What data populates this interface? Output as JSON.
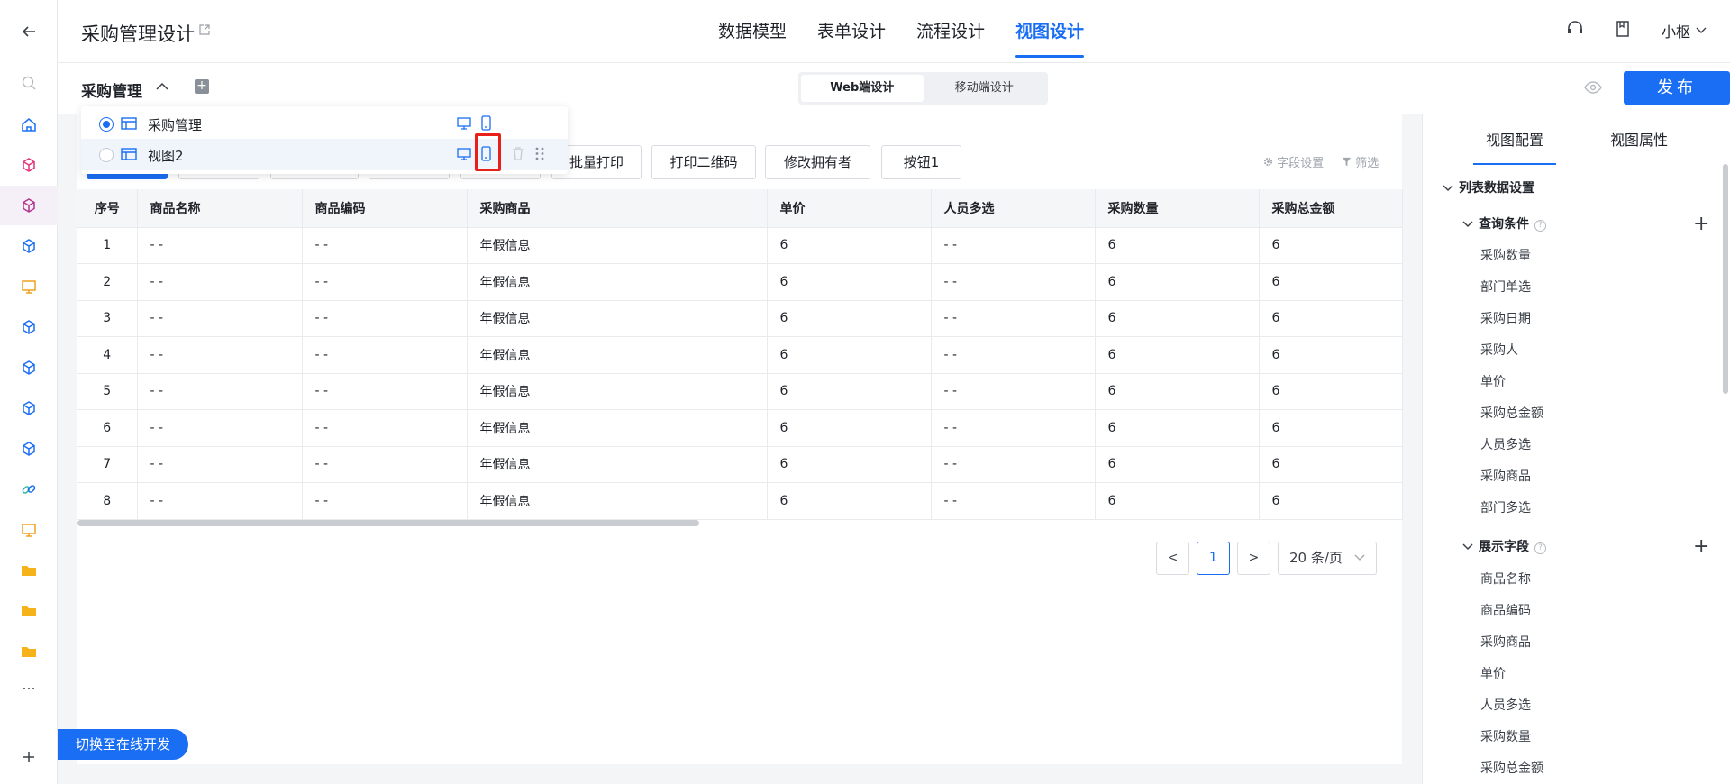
{
  "header": {
    "app_title": "采购管理设计",
    "tabs": [
      "数据模型",
      "表单设计",
      "流程设计",
      "视图设计"
    ],
    "active_tab": "视图设计",
    "user_name": "小枢"
  },
  "subheader": {
    "view_title": "采购管理",
    "mode_web": "Web端设计",
    "mode_mobile": "移动端设计",
    "publish_label": "发布"
  },
  "view_list": [
    {
      "name": "采购管理",
      "selected": true
    },
    {
      "name": "视图2",
      "selected": false
    }
  ],
  "toolbar": {
    "buttons": [
      "批量打印",
      "打印二维码",
      "修改拥有者",
      "按钮1"
    ],
    "field_settings": "字段设置",
    "filter": "筛选"
  },
  "table": {
    "columns": [
      "序号",
      "商品名称",
      "商品编码",
      "采购商品",
      "单价",
      "人员多选",
      "采购数量",
      "采购总金额"
    ],
    "rows": [
      [
        "1",
        "- -",
        "- -",
        "年假信息",
        "6",
        "- -",
        "6",
        "6"
      ],
      [
        "2",
        "- -",
        "- -",
        "年假信息",
        "6",
        "- -",
        "6",
        "6"
      ],
      [
        "3",
        "- -",
        "- -",
        "年假信息",
        "6",
        "- -",
        "6",
        "6"
      ],
      [
        "4",
        "- -",
        "- -",
        "年假信息",
        "6",
        "- -",
        "6",
        "6"
      ],
      [
        "5",
        "- -",
        "- -",
        "年假信息",
        "6",
        "- -",
        "6",
        "6"
      ],
      [
        "6",
        "- -",
        "- -",
        "年假信息",
        "6",
        "- -",
        "6",
        "6"
      ],
      [
        "7",
        "- -",
        "- -",
        "年假信息",
        "6",
        "- -",
        "6",
        "6"
      ],
      [
        "8",
        "- -",
        "- -",
        "年假信息",
        "6",
        "- -",
        "6",
        "6"
      ]
    ]
  },
  "pagination": {
    "prev": "<",
    "current_page": "1",
    "next": ">",
    "page_size": "20 条/页"
  },
  "right_panel": {
    "tabs": [
      "视图配置",
      "视图属性"
    ],
    "active_tab": "视图配置",
    "section_title": "列表数据设置",
    "query_title": "查询条件",
    "query_items": [
      "采购数量",
      "部门单选",
      "采购日期",
      "采购人",
      "单价",
      "采购总金额",
      "人员多选",
      "采购商品",
      "部门多选"
    ],
    "display_title": "展示字段",
    "display_items": [
      "商品名称",
      "商品编码",
      "采购商品",
      "单价",
      "人员多选",
      "采购数量",
      "采购总金额"
    ]
  },
  "switch_dev_label": "切换至在线开发",
  "colors": {
    "primary": "#1a6ef4",
    "highlight": "#e8201a"
  },
  "icons": [
    "back-arrow-icon",
    "search-icon",
    "home-icon",
    "cube-icon",
    "monitor-icon",
    "link-icon",
    "folder-icon",
    "more-icon",
    "plus-icon",
    "headset-icon",
    "document-icon",
    "eye-icon",
    "desktop-icon",
    "mobile-icon",
    "table-icon",
    "trash-icon",
    "drag-handle-icon",
    "gear-icon",
    "filter-icon"
  ]
}
